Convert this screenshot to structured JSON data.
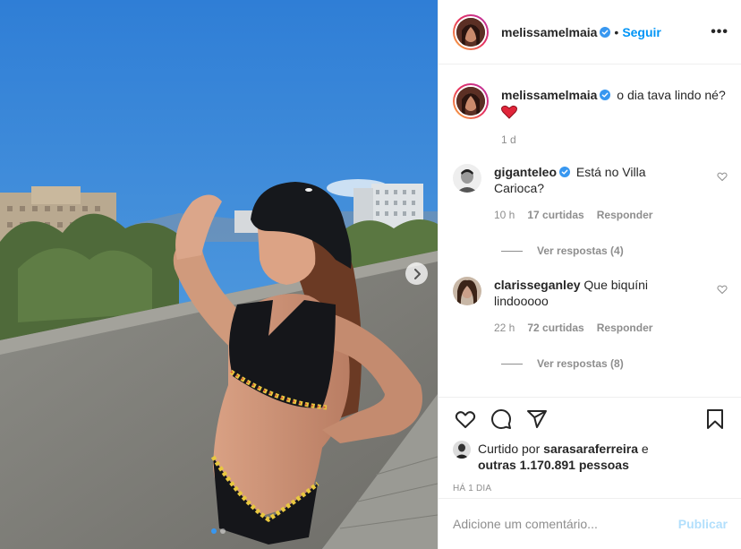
{
  "post": {
    "author": "melissamelmaia",
    "follow_label": "Seguir",
    "separator": "•",
    "more_label": "•••"
  },
  "caption": {
    "author": "melissamelmaia",
    "text": "o dia tava lindo né?",
    "emoji": "❤️",
    "time": "1 d"
  },
  "comments": [
    {
      "author": "giganteleo",
      "verified": true,
      "text": "Está no Villa Carioca?",
      "time": "10 h",
      "likes": "17 curtidas",
      "reply": "Responder",
      "view_replies": "Ver respostas (4)"
    },
    {
      "author": "clarisseganley",
      "verified": false,
      "text": "Que biquíni lindooooo",
      "time": "22 h",
      "likes": "72 curtidas",
      "reply": "Responder",
      "view_replies": "Ver respostas (8)"
    }
  ],
  "likes": {
    "prefix": "Curtido por",
    "user": "sarasaraferreira",
    "conj": "e",
    "others": "outras 1.170.891 pessoas"
  },
  "date": "HÁ 1 DIA",
  "add_comment": {
    "placeholder": "Adicione um comentário...",
    "publish": "Publicar"
  },
  "icons": {
    "like": "heart-icon",
    "comment": "comment-icon",
    "share": "share-icon",
    "save": "bookmark-icon",
    "next": "chevron-right-icon",
    "verified": "verified-badge-icon"
  },
  "colors": {
    "accent": "#0095f6",
    "verified": "#3897f0",
    "heart": "#ed4956",
    "muted": "#8e8e8e",
    "publish_disabled": "#b2dffc"
  },
  "carousel": {
    "count": 2,
    "active": 1
  }
}
